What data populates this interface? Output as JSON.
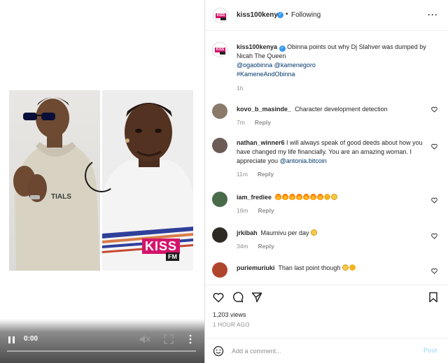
{
  "video": {
    "time": "0:00",
    "kiss_label": "KISS",
    "fm_label": "FM",
    "photo_caption_text": "TIALS"
  },
  "header": {
    "avatar_label": "KISS",
    "username": "kiss100kenya",
    "verified_mark": "✓",
    "dot": "•",
    "following": "Following",
    "more": "···"
  },
  "caption": {
    "avatar_label": "KISS",
    "username": "kiss100kenya",
    "verified_mark": "✓",
    "text": "Obinna points out why Dj Slahver was dumped by Nicah The Queen",
    "mentions": "@ogaobinna @kamenegoro",
    "hashtag": "#KameneAndObinna",
    "time": "1h"
  },
  "comments": [
    {
      "username": "kovo_b_masinde_",
      "text": "Character development detection",
      "time": "7m",
      "reply": "Reply",
      "avatar_color": "#8a7a6a"
    },
    {
      "username": "nathan_winner6",
      "text": "I will always speak of good deeds about how you have changed my life financially. You are an amazing woman. I appreciate you",
      "mention": "@antonia.bitcoin",
      "time": "11m",
      "reply": "Reply",
      "avatar_color": "#6b5c57"
    },
    {
      "username": "iam_frediee",
      "emoji": [
        "fire",
        "fire",
        "fire",
        "fire",
        "fire",
        "fire",
        "fire",
        "clap",
        "laugh"
      ],
      "time": "16m",
      "reply": "Reply",
      "avatar_color": "#4a6b4a"
    },
    {
      "username": "jrkibah",
      "text": "Maumivu per day",
      "emoji": [
        "laugh"
      ],
      "time": "34m",
      "reply": "Reply",
      "avatar_color": "#2f2a24"
    },
    {
      "username": "puriemuriuki",
      "text": "Than last point though",
      "emoji": [
        "laugh",
        "clap"
      ],
      "time": "",
      "reply": "",
      "avatar_color": "#b0452e"
    }
  ],
  "stats": {
    "views": "1,203 views",
    "posted": "1 HOUR AGO"
  },
  "composer": {
    "placeholder": "Add a comment...",
    "post_label": "Post"
  },
  "colors": {
    "verified": "#3897f0",
    "kiss_brand": "#d4146c",
    "link": "#00376b",
    "post_disabled": "#b2dffc"
  }
}
